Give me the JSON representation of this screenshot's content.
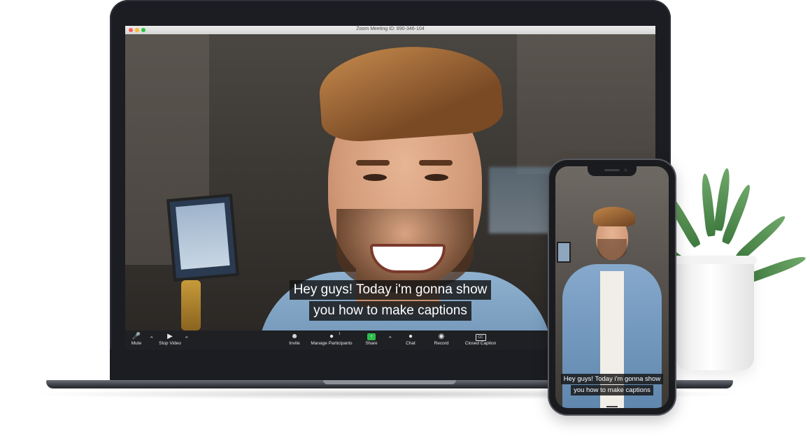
{
  "window": {
    "title": "Zoom Meeting ID: 890-346-104"
  },
  "captions": {
    "laptop": [
      "Hey guys! Today i'm gonna show",
      "you how to make captions"
    ],
    "phone": [
      "Hey guys! Today i'm gonna show",
      "you how to make captions"
    ]
  },
  "toolbar": {
    "mute": "Mute",
    "stop_video": "Stop Video",
    "invite": "Invite",
    "manage_participants": "Manage Participants",
    "participants_count": "1",
    "share": "Share",
    "chat": "Chat",
    "record": "Record",
    "closed_caption": "Closed Caption",
    "cc_badge": "CC"
  },
  "colors": {
    "share_accent": "#2dbb4c",
    "toolbar_bg": "#1f2023",
    "caption_bg": "#141414"
  },
  "icons": {
    "mute": "microphone-icon",
    "video": "video-camera-icon",
    "invite": "invite-person-icon",
    "participants": "participants-icon",
    "share": "share-screen-icon",
    "chat": "chat-bubble-icon",
    "record": "record-icon",
    "closed_caption": "cc-icon"
  }
}
